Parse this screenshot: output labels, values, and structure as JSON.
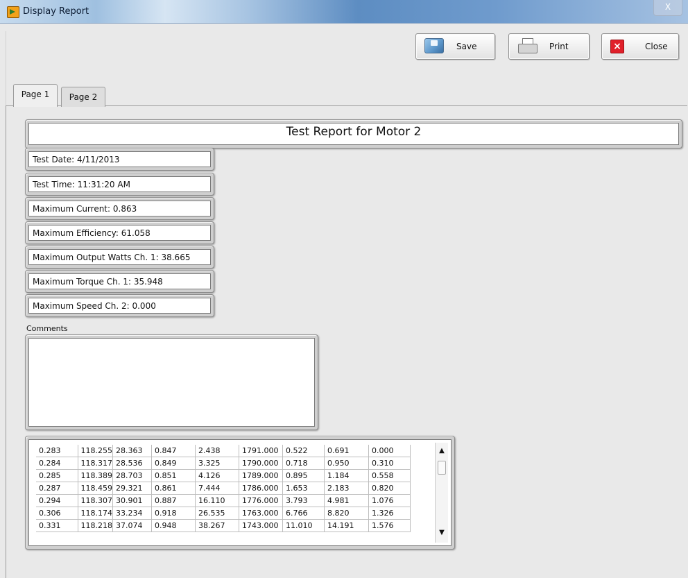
{
  "window": {
    "title": "Display Report",
    "close_glyph": "X",
    "icon": "labview-vi-icon"
  },
  "toolbar": {
    "save_label": "Save",
    "print_label": "Print",
    "close_label": "Close"
  },
  "tabs": [
    {
      "label": "Page 1",
      "active": true
    },
    {
      "label": "Page 2",
      "active": false
    }
  ],
  "report": {
    "title": "Test Report for Motor 2",
    "fields": [
      "Test Date:  4/11/2013",
      "Test Time:  11:31:20 AM",
      "Maximum Current:  0.863",
      "Maximum Efficiency:  61.058",
      "Maximum Output Watts Ch. 1:  38.665",
      "Maximum Torque Ch. 1:  35.948",
      "Maximum Speed Ch. 2:  0.000"
    ],
    "comments_label": "Comments",
    "comments_value": ""
  },
  "table": {
    "rows": [
      [
        "0.283",
        "118.255",
        "28.363",
        "0.847",
        "2.438",
        "1791.000",
        "0.522",
        "0.691",
        "0.000"
      ],
      [
        "0.284",
        "118.317",
        "28.536",
        "0.849",
        "3.325",
        "1790.000",
        "0.718",
        "0.950",
        "0.310"
      ],
      [
        "0.285",
        "118.389",
        "28.703",
        "0.851",
        "4.126",
        "1789.000",
        "0.895",
        "1.184",
        "0.558"
      ],
      [
        "0.287",
        "118.459",
        "29.321",
        "0.861",
        "7.444",
        "1786.000",
        "1.653",
        "2.183",
        "0.820"
      ],
      [
        "0.294",
        "118.307",
        "30.901",
        "0.887",
        "16.110",
        "1776.000",
        "3.793",
        "4.981",
        "1.076"
      ],
      [
        "0.306",
        "118.174",
        "33.234",
        "0.918",
        "26.535",
        "1763.000",
        "6.766",
        "8.820",
        "1.326"
      ],
      [
        "0.331",
        "118.218",
        "37.074",
        "0.948",
        "38.267",
        "1743.000",
        "11.010",
        "14.191",
        "1.576"
      ]
    ],
    "scroll_up_glyph": "▲",
    "scroll_down_glyph": "▼"
  },
  "colors": {
    "titlebar": "#6f9bcd",
    "panel": "#e9e9e9",
    "close_icon": "#e0202a"
  }
}
